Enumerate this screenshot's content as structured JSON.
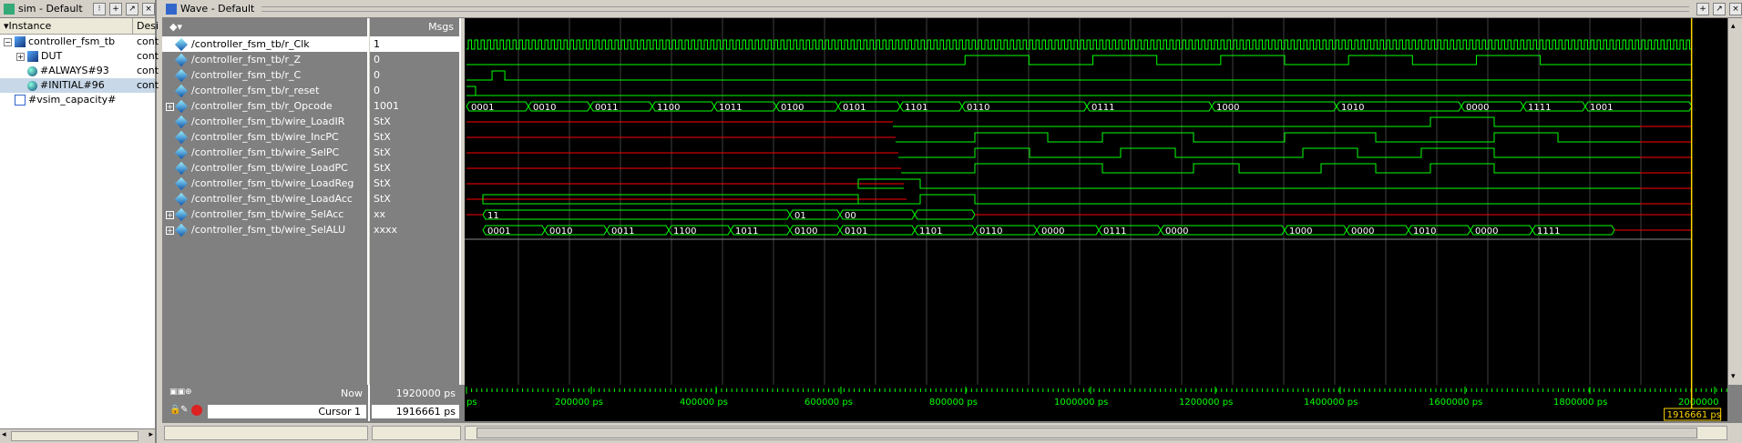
{
  "sim_pane": {
    "title": "sim - Default",
    "col_instance": "Instance",
    "col_design": "Desi",
    "tree": [
      {
        "label": "controller_fsm_tb",
        "design": "cont",
        "expanded": true,
        "level": 0
      },
      {
        "label": "DUT",
        "design": "cont",
        "expanded": false,
        "level": 1
      },
      {
        "label": "#ALWAYS#93",
        "design": "cont",
        "level": 1
      },
      {
        "label": "#INITIAL#96",
        "design": "cont",
        "level": 1,
        "selected": true
      },
      {
        "label": "#vsim_capacity#",
        "design": "",
        "level": 0
      }
    ]
  },
  "wave_pane": {
    "title": "Wave - Default",
    "msgs_header": "Msgs",
    "signals": [
      {
        "name": "/controller_fsm_tb/r_Clk",
        "value": "1",
        "expandable": false,
        "selected": true
      },
      {
        "name": "/controller_fsm_tb/r_Z",
        "value": "0",
        "expandable": false
      },
      {
        "name": "/controller_fsm_tb/r_C",
        "value": "0",
        "expandable": false
      },
      {
        "name": "/controller_fsm_tb/r_reset",
        "value": "0",
        "expandable": false
      },
      {
        "name": "/controller_fsm_tb/r_Opcode",
        "value": "1001",
        "expandable": true
      },
      {
        "name": "/controller_fsm_tb/wire_LoadIR",
        "value": "StX",
        "expandable": false
      },
      {
        "name": "/controller_fsm_tb/wire_IncPC",
        "value": "StX",
        "expandable": false
      },
      {
        "name": "/controller_fsm_tb/wire_SelPC",
        "value": "StX",
        "expandable": false
      },
      {
        "name": "/controller_fsm_tb/wire_LoadPC",
        "value": "StX",
        "expandable": false
      },
      {
        "name": "/controller_fsm_tb/wire_LoadReg",
        "value": "StX",
        "expandable": false
      },
      {
        "name": "/controller_fsm_tb/wire_LoadAcc",
        "value": "StX",
        "expandable": false
      },
      {
        "name": "/controller_fsm_tb/wire_SelAcc",
        "value": "xx",
        "expandable": true
      },
      {
        "name": "/controller_fsm_tb/wire_SelALU",
        "value": "xxxx",
        "expandable": true
      }
    ],
    "bus_opcode": [
      "0001",
      "0010",
      "0011",
      "1100",
      "1011",
      "0100",
      "0101",
      "1101",
      "0110",
      "0111",
      "1000",
      "1010",
      "0000",
      "1111",
      "1001"
    ],
    "bus_selacc": [
      "11",
      "01",
      "00"
    ],
    "bus_selalu": [
      "0001",
      "0010",
      "0011",
      "1100",
      "1011",
      "0100",
      "0101",
      "1101",
      "0110",
      "0000",
      "0111",
      "0000",
      "1000",
      "0000",
      "1010",
      "0000",
      "1111"
    ],
    "now_label": "Now",
    "now_value": "1920000 ps",
    "cursor_label": "Cursor 1",
    "cursor_value": "1916661 ps",
    "cursor_flag": "1916661 ps",
    "ticks": [
      "ps",
      "200000 ps",
      "400000 ps",
      "600000 ps",
      "800000 ps",
      "1000000 ps",
      "1200000 ps",
      "1400000 ps",
      "1600000 ps",
      "1800000 ps",
      "2000000"
    ],
    "colors": {
      "wave": "#00ff00",
      "unknown": "#ff0000",
      "cursor": "#ffd700",
      "grid": "#404040"
    }
  }
}
